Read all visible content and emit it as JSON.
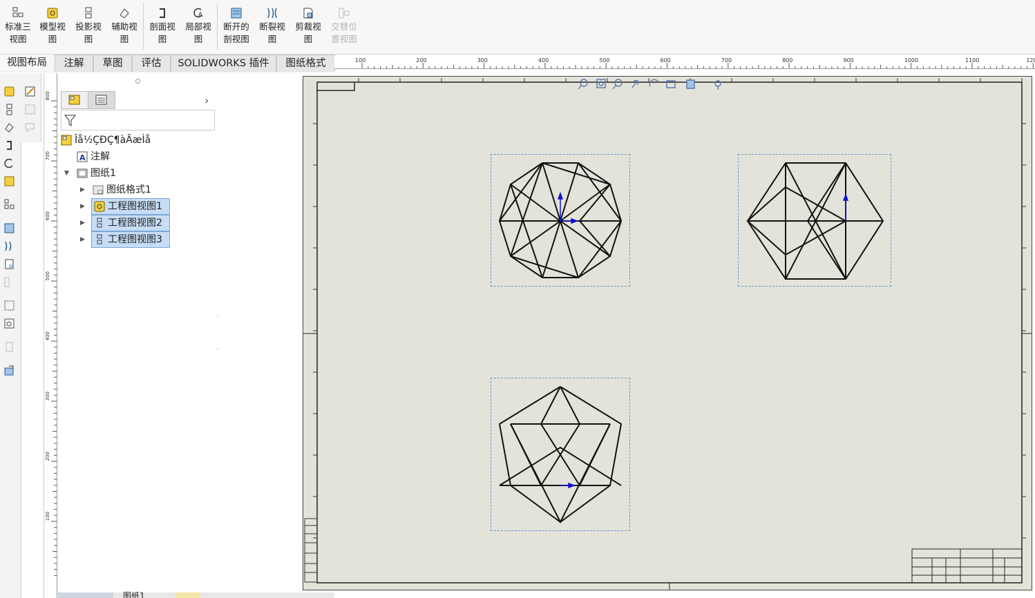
{
  "ribbon": {
    "buttons": [
      {
        "label": "标准三\n视图",
        "icon": "standard-three-view-icon",
        "enabled": true
      },
      {
        "label": "模型视\n图",
        "icon": "model-view-icon",
        "enabled": true
      },
      {
        "label": "投影视\n图",
        "icon": "projected-view-icon",
        "enabled": true
      },
      {
        "label": "辅助视\n图",
        "icon": "auxiliary-view-icon",
        "enabled": true
      },
      {
        "label": "剖面视\n图",
        "icon": "section-view-icon",
        "enabled": true
      },
      {
        "label": "局部视\n图",
        "icon": "detail-view-icon",
        "enabled": true
      },
      {
        "label": "断开的\n剖视图",
        "icon": "broken-out-section-icon",
        "enabled": true
      },
      {
        "label": "断裂视\n图",
        "icon": "break-view-icon",
        "enabled": true
      },
      {
        "label": "剪裁视\n图",
        "icon": "crop-view-icon",
        "enabled": true
      },
      {
        "label": "交替位\n置视图",
        "icon": "alternate-position-view-icon",
        "enabled": false
      }
    ]
  },
  "tabs": [
    {
      "label": "视图布局",
      "active": true
    },
    {
      "label": "注解",
      "active": false
    },
    {
      "label": "草图",
      "active": false
    },
    {
      "label": "评估",
      "active": false
    },
    {
      "label": "SOLIDWORKS 插件",
      "active": false
    },
    {
      "label": "图纸格式",
      "active": false
    }
  ],
  "ruler_top": [
    "100",
    "200",
    "300",
    "400",
    "500",
    "600",
    "700",
    "800",
    "900",
    "1000",
    "1100",
    "120"
  ],
  "ruler_left": [
    "800",
    "700",
    "600",
    "500",
    "400",
    "300",
    "200",
    "100"
  ],
  "tree": {
    "root": "Îå½ÇÐÇ¶àÃæÌå",
    "annotations": "注解",
    "sheet": "图纸1",
    "sheet_format": "图纸格式1",
    "views": [
      "工程图视图1",
      "工程图视图2",
      "工程图视图3"
    ]
  },
  "bottom_tabs": [
    "图纸1"
  ],
  "colors": {
    "sheet": "#e4e3da",
    "selection": "#c6ddf5",
    "view_border": "#5a9ad6",
    "axis": "#1010d0"
  }
}
